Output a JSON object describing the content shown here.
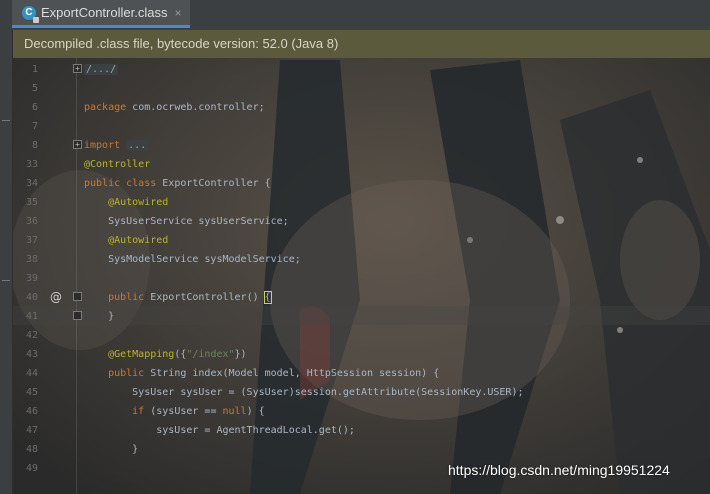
{
  "tab": {
    "icon_letter": "C",
    "title": "ExportController.class",
    "close": "×"
  },
  "banner": {
    "text": "Decompiled .class file, bytecode version: 52.0 (Java 8)"
  },
  "editor": {
    "lines": [
      {
        "num": "1",
        "tokens": [
          {
            "t": "/.../",
            "c": "collapsed"
          }
        ]
      },
      {
        "num": "5",
        "tokens": []
      },
      {
        "num": "6",
        "tokens": [
          {
            "t": "package ",
            "c": "kw"
          },
          {
            "t": "com.ocrweb.controller;",
            "c": ""
          }
        ]
      },
      {
        "num": "7",
        "tokens": []
      },
      {
        "num": "8",
        "tokens": [
          {
            "t": "import ",
            "c": "kw"
          },
          {
            "t": "...",
            "c": "collapsed"
          }
        ]
      },
      {
        "num": "33",
        "tokens": [
          {
            "t": "@Controller",
            "c": "ann"
          }
        ]
      },
      {
        "num": "34",
        "tokens": [
          {
            "t": "public class ",
            "c": "kw"
          },
          {
            "t": "ExportController {",
            "c": ""
          }
        ]
      },
      {
        "num": "35",
        "tokens": [
          {
            "t": "    @Autowired",
            "c": "ann"
          }
        ]
      },
      {
        "num": "36",
        "tokens": [
          {
            "t": "    SysUserService sysUserService;",
            "c": ""
          }
        ]
      },
      {
        "num": "37",
        "tokens": [
          {
            "t": "    @Autowired",
            "c": "ann"
          }
        ]
      },
      {
        "num": "38",
        "tokens": [
          {
            "t": "    SysModelService sysModelService;",
            "c": ""
          }
        ]
      },
      {
        "num": "39",
        "tokens": []
      },
      {
        "num": "40",
        "tokens": [
          {
            "t": "    public ",
            "c": "kw"
          },
          {
            "t": "ExportController() ",
            "c": ""
          },
          {
            "t": "{",
            "c": "brace-hl"
          }
        ]
      },
      {
        "num": "41",
        "tokens": [
          {
            "t": "    }",
            "c": ""
          }
        ]
      },
      {
        "num": "42",
        "tokens": []
      },
      {
        "num": "43",
        "tokens": [
          {
            "t": "    @GetMapping",
            "c": "ann"
          },
          {
            "t": "({",
            "c": ""
          },
          {
            "t": "\"/index\"",
            "c": "str"
          },
          {
            "t": "})",
            "c": ""
          }
        ]
      },
      {
        "num": "44",
        "tokens": [
          {
            "t": "    public ",
            "c": "kw"
          },
          {
            "t": "String index(Model model, HttpSession session) {",
            "c": ""
          }
        ]
      },
      {
        "num": "45",
        "tokens": [
          {
            "t": "        SysUser sysUser = (SysUser)session.getAttribute(SessionKey.USER);",
            "c": ""
          }
        ]
      },
      {
        "num": "46",
        "tokens": [
          {
            "t": "        if ",
            "c": "kw"
          },
          {
            "t": "(sysUser == ",
            "c": ""
          },
          {
            "t": "null",
            "c": "kw"
          },
          {
            "t": ") {",
            "c": ""
          }
        ]
      },
      {
        "num": "47",
        "tokens": [
          {
            "t": "            sysUser = AgentThreadLocal.get();",
            "c": ""
          }
        ]
      },
      {
        "num": "48",
        "tokens": [
          {
            "t": "        }",
            "c": ""
          }
        ]
      },
      {
        "num": "49",
        "tokens": []
      }
    ],
    "gutter_icon": "@",
    "fold_symbol": "+"
  },
  "watermark": "https://blog.csdn.net/ming19951224",
  "colors": {
    "keyword": "#cc7832",
    "annotation": "#bbb529",
    "string": "#6a8759",
    "text": "#a9b7c6",
    "banner": "#5c5a3c",
    "tab_underline": "#4a88c7"
  }
}
